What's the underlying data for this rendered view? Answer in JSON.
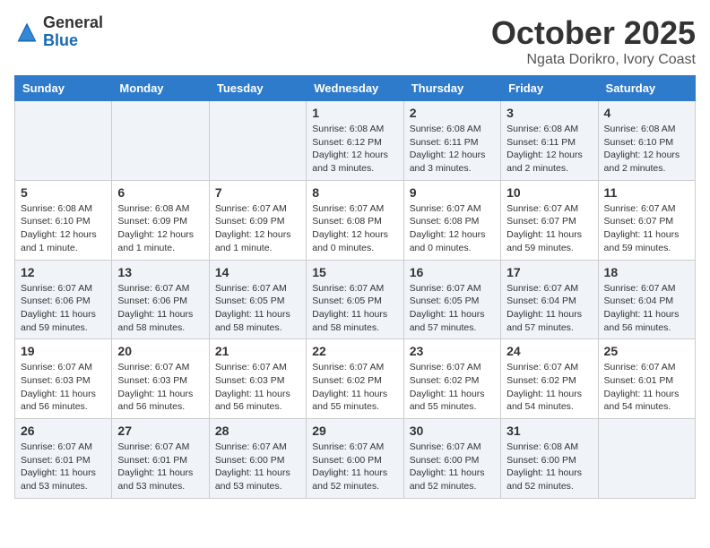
{
  "header": {
    "logo_general": "General",
    "logo_blue": "Blue",
    "month": "October 2025",
    "location": "Ngata Dorikro, Ivory Coast"
  },
  "days_of_week": [
    "Sunday",
    "Monday",
    "Tuesday",
    "Wednesday",
    "Thursday",
    "Friday",
    "Saturday"
  ],
  "weeks": [
    [
      {
        "day": "",
        "info": ""
      },
      {
        "day": "",
        "info": ""
      },
      {
        "day": "",
        "info": ""
      },
      {
        "day": "1",
        "info": "Sunrise: 6:08 AM\nSunset: 6:12 PM\nDaylight: 12 hours\nand 3 minutes."
      },
      {
        "day": "2",
        "info": "Sunrise: 6:08 AM\nSunset: 6:11 PM\nDaylight: 12 hours\nand 3 minutes."
      },
      {
        "day": "3",
        "info": "Sunrise: 6:08 AM\nSunset: 6:11 PM\nDaylight: 12 hours\nand 2 minutes."
      },
      {
        "day": "4",
        "info": "Sunrise: 6:08 AM\nSunset: 6:10 PM\nDaylight: 12 hours\nand 2 minutes."
      }
    ],
    [
      {
        "day": "5",
        "info": "Sunrise: 6:08 AM\nSunset: 6:10 PM\nDaylight: 12 hours\nand 1 minute."
      },
      {
        "day": "6",
        "info": "Sunrise: 6:08 AM\nSunset: 6:09 PM\nDaylight: 12 hours\nand 1 minute."
      },
      {
        "day": "7",
        "info": "Sunrise: 6:07 AM\nSunset: 6:09 PM\nDaylight: 12 hours\nand 1 minute."
      },
      {
        "day": "8",
        "info": "Sunrise: 6:07 AM\nSunset: 6:08 PM\nDaylight: 12 hours\nand 0 minutes."
      },
      {
        "day": "9",
        "info": "Sunrise: 6:07 AM\nSunset: 6:08 PM\nDaylight: 12 hours\nand 0 minutes."
      },
      {
        "day": "10",
        "info": "Sunrise: 6:07 AM\nSunset: 6:07 PM\nDaylight: 11 hours\nand 59 minutes."
      },
      {
        "day": "11",
        "info": "Sunrise: 6:07 AM\nSunset: 6:07 PM\nDaylight: 11 hours\nand 59 minutes."
      }
    ],
    [
      {
        "day": "12",
        "info": "Sunrise: 6:07 AM\nSunset: 6:06 PM\nDaylight: 11 hours\nand 59 minutes."
      },
      {
        "day": "13",
        "info": "Sunrise: 6:07 AM\nSunset: 6:06 PM\nDaylight: 11 hours\nand 58 minutes."
      },
      {
        "day": "14",
        "info": "Sunrise: 6:07 AM\nSunset: 6:05 PM\nDaylight: 11 hours\nand 58 minutes."
      },
      {
        "day": "15",
        "info": "Sunrise: 6:07 AM\nSunset: 6:05 PM\nDaylight: 11 hours\nand 58 minutes."
      },
      {
        "day": "16",
        "info": "Sunrise: 6:07 AM\nSunset: 6:05 PM\nDaylight: 11 hours\nand 57 minutes."
      },
      {
        "day": "17",
        "info": "Sunrise: 6:07 AM\nSunset: 6:04 PM\nDaylight: 11 hours\nand 57 minutes."
      },
      {
        "day": "18",
        "info": "Sunrise: 6:07 AM\nSunset: 6:04 PM\nDaylight: 11 hours\nand 56 minutes."
      }
    ],
    [
      {
        "day": "19",
        "info": "Sunrise: 6:07 AM\nSunset: 6:03 PM\nDaylight: 11 hours\nand 56 minutes."
      },
      {
        "day": "20",
        "info": "Sunrise: 6:07 AM\nSunset: 6:03 PM\nDaylight: 11 hours\nand 56 minutes."
      },
      {
        "day": "21",
        "info": "Sunrise: 6:07 AM\nSunset: 6:03 PM\nDaylight: 11 hours\nand 56 minutes."
      },
      {
        "day": "22",
        "info": "Sunrise: 6:07 AM\nSunset: 6:02 PM\nDaylight: 11 hours\nand 55 minutes."
      },
      {
        "day": "23",
        "info": "Sunrise: 6:07 AM\nSunset: 6:02 PM\nDaylight: 11 hours\nand 55 minutes."
      },
      {
        "day": "24",
        "info": "Sunrise: 6:07 AM\nSunset: 6:02 PM\nDaylight: 11 hours\nand 54 minutes."
      },
      {
        "day": "25",
        "info": "Sunrise: 6:07 AM\nSunset: 6:01 PM\nDaylight: 11 hours\nand 54 minutes."
      }
    ],
    [
      {
        "day": "26",
        "info": "Sunrise: 6:07 AM\nSunset: 6:01 PM\nDaylight: 11 hours\nand 53 minutes."
      },
      {
        "day": "27",
        "info": "Sunrise: 6:07 AM\nSunset: 6:01 PM\nDaylight: 11 hours\nand 53 minutes."
      },
      {
        "day": "28",
        "info": "Sunrise: 6:07 AM\nSunset: 6:00 PM\nDaylight: 11 hours\nand 53 minutes."
      },
      {
        "day": "29",
        "info": "Sunrise: 6:07 AM\nSunset: 6:00 PM\nDaylight: 11 hours\nand 52 minutes."
      },
      {
        "day": "30",
        "info": "Sunrise: 6:07 AM\nSunset: 6:00 PM\nDaylight: 11 hours\nand 52 minutes."
      },
      {
        "day": "31",
        "info": "Sunrise: 6:08 AM\nSunset: 6:00 PM\nDaylight: 11 hours\nand 52 minutes."
      },
      {
        "day": "",
        "info": ""
      }
    ]
  ]
}
